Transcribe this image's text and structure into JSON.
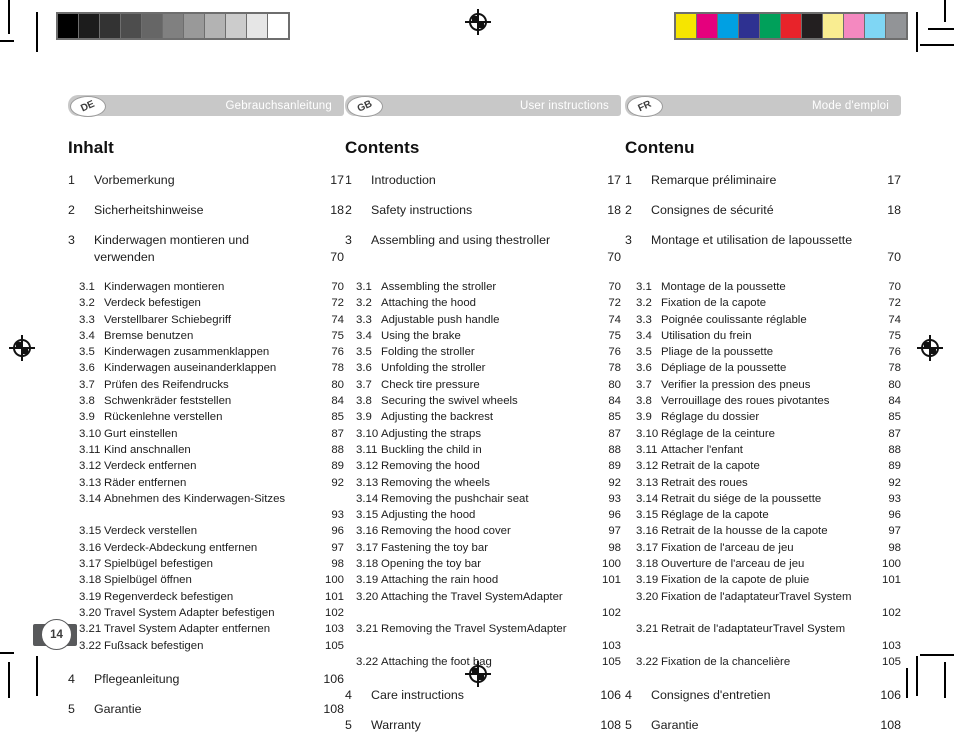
{
  "print_marks": {
    "gray_wedge": [
      "#000000",
      "#1c1c1c",
      "#333333",
      "#4d4d4d",
      "#666666",
      "#808080",
      "#999999",
      "#b3b3b3",
      "#cccccc",
      "#e6e6e6",
      "#ffffff"
    ],
    "color_bar": [
      "#f6e500",
      "#e5007d",
      "#00a0e3",
      "#2e3191",
      "#00a05a",
      "#e8232a",
      "#231f20",
      "#f9ed91",
      "#f489c0",
      "#7fd6f4",
      "#929497"
    ]
  },
  "page_footer": {
    "page_number": "14"
  },
  "columns": [
    {
      "code": "DE",
      "header": "Gebrauchsanleitung",
      "title": "Inhalt",
      "entries": [
        {
          "level": 1,
          "num": "1",
          "text": "Vorbemerkung",
          "page": "17"
        },
        {
          "level": 1,
          "num": "2",
          "text": "Sicherheitshinweise",
          "page": "18"
        },
        {
          "level": 1,
          "num": "3",
          "text": "Kinderwagen montieren und verwenden",
          "page": "70",
          "wrap": true
        },
        {
          "level": 2,
          "num": "3.1",
          "text": "Kinderwagen montieren",
          "page": "70"
        },
        {
          "level": 2,
          "num": "3.2",
          "text": "Verdeck befestigen",
          "page": "72"
        },
        {
          "level": 2,
          "num": "3.3",
          "text": "Verstellbarer Schiebegriff",
          "page": "74"
        },
        {
          "level": 2,
          "num": "3.4",
          "text": "Bremse benutzen",
          "page": "75"
        },
        {
          "level": 2,
          "num": "3.5",
          "text": "Kinderwagen zusammenklappen",
          "page": "76"
        },
        {
          "level": 2,
          "num": "3.6",
          "text": "Kinderwagen auseinanderklappen",
          "page": "78"
        },
        {
          "level": 2,
          "num": "3.7",
          "text": "Prüfen des Reifendrucks",
          "page": "80"
        },
        {
          "level": 2,
          "num": "3.8",
          "text": "Schwenkräder feststellen",
          "page": "84"
        },
        {
          "level": 2,
          "num": "3.9",
          "text": "Rückenlehne verstellen",
          "page": "85"
        },
        {
          "level": 2,
          "num": "3.10",
          "text": "Gurt einstellen",
          "page": "87"
        },
        {
          "level": 2,
          "num": "3.11",
          "text": "Kind anschnallen",
          "page": "88"
        },
        {
          "level": 2,
          "num": "3.12",
          "text": "Verdeck entfernen",
          "page": "89"
        },
        {
          "level": 2,
          "num": "3.13",
          "text": "Räder entfernen",
          "page": "92"
        },
        {
          "level": 2,
          "num": "3.14",
          "text": "Abnehmen des Kinderwagen-Sitzes",
          "page": "93",
          "wrap": true,
          "line1": "Abnehmen des Kinderwagen-",
          "line2": "Sitzes"
        },
        {
          "level": 2,
          "num": "3.15",
          "text": "Verdeck verstellen",
          "page": "96"
        },
        {
          "level": 2,
          "num": "3.16",
          "text": "Verdeck-Abdeckung entfernen",
          "page": "97"
        },
        {
          "level": 2,
          "num": "3.17",
          "text": "Spielbügel befestigen",
          "page": "98"
        },
        {
          "level": 2,
          "num": "3.18",
          "text": "Spielbügel öffnen",
          "page": "100"
        },
        {
          "level": 2,
          "num": "3.19",
          "text": "Regenverdeck befestigen",
          "page": "101"
        },
        {
          "level": 2,
          "num": "3.20",
          "text": "Travel System Adapter befestigen",
          "page": "102"
        },
        {
          "level": 2,
          "num": "3.21",
          "text": "Travel System Adapter entfernen",
          "page": "103"
        },
        {
          "level": 2,
          "num": "3.22",
          "text": "Fußsack befestigen",
          "page": "105"
        },
        {
          "level": 1,
          "num": "4",
          "text": "Pflegeanleitung",
          "page": "106",
          "spaced": true
        },
        {
          "level": 1,
          "num": "5",
          "text": "Garantie",
          "page": "108"
        }
      ]
    },
    {
      "code": "GB",
      "header": "User instructions",
      "title": "Contents",
      "entries": [
        {
          "level": 1,
          "num": "1",
          "text": "Introduction",
          "page": "17"
        },
        {
          "level": 1,
          "num": "2",
          "text": "Safety instructions",
          "page": "18"
        },
        {
          "level": 1,
          "num": "3",
          "text": "Assembling and using the stroller",
          "page": "70",
          "wrap": true,
          "line1": "Assembling and using the",
          "line2": "stroller"
        },
        {
          "level": 2,
          "num": "3.1",
          "text": "Assembling the stroller",
          "page": "70"
        },
        {
          "level": 2,
          "num": "3.2",
          "text": "Attaching the hood",
          "page": "72"
        },
        {
          "level": 2,
          "num": "3.3",
          "text": "Adjustable push handle",
          "page": "74"
        },
        {
          "level": 2,
          "num": "3.4",
          "text": "Using the brake",
          "page": "75"
        },
        {
          "level": 2,
          "num": "3.5",
          "text": "Folding the stroller",
          "page": "76"
        },
        {
          "level": 2,
          "num": "3.6",
          "text": "Unfolding the stroller",
          "page": "78"
        },
        {
          "level": 2,
          "num": "3.7",
          "text": "Check tire pressure",
          "page": "80"
        },
        {
          "level": 2,
          "num": "3.8",
          "text": "Securing the swivel wheels",
          "page": "84"
        },
        {
          "level": 2,
          "num": "3.9",
          "text": "Adjusting the backrest",
          "page": "85"
        },
        {
          "level": 2,
          "num": "3.10",
          "text": "Adjusting the straps",
          "page": "87"
        },
        {
          "level": 2,
          "num": "3.11",
          "text": "Buckling the child in",
          "page": "88"
        },
        {
          "level": 2,
          "num": "3.12",
          "text": "Removing the hood",
          "page": "89"
        },
        {
          "level": 2,
          "num": "3.13",
          "text": "Removing the wheels",
          "page": "92"
        },
        {
          "level": 2,
          "num": "3.14",
          "text": "Removing the pushchair seat",
          "page": "93"
        },
        {
          "level": 2,
          "num": "3.15",
          "text": "Adjusting the hood",
          "page": "96"
        },
        {
          "level": 2,
          "num": "3.16",
          "text": "Removing the hood cover",
          "page": "97"
        },
        {
          "level": 2,
          "num": "3.17",
          "text": "Fastening the toy bar",
          "page": "98"
        },
        {
          "level": 2,
          "num": "3.18",
          "text": "Opening the toy bar",
          "page": "100"
        },
        {
          "level": 2,
          "num": "3.19",
          "text": "Attaching the rain hood",
          "page": "101"
        },
        {
          "level": 2,
          "num": "3.20",
          "text": "Attaching the Travel System Adapter",
          "page": "102",
          "wrap": true,
          "line1": "Attaching the Travel System",
          "line2": "Adapter"
        },
        {
          "level": 2,
          "num": "3.21",
          "text": "Removing the Travel System Adapter",
          "page": "103",
          "wrap": true,
          "line1": "Removing the Travel System",
          "line2": "Adapter"
        },
        {
          "level": 2,
          "num": "3.22",
          "text": "Attaching the foot bag",
          "page": "105"
        },
        {
          "level": 1,
          "num": "4",
          "text": "Care instructions",
          "page": "106",
          "spaced": true
        },
        {
          "level": 1,
          "num": "5",
          "text": "Warranty",
          "page": "108"
        }
      ]
    },
    {
      "code": "FR",
      "header": "Mode d'emploi",
      "title": "Contenu",
      "entries": [
        {
          "level": 1,
          "num": "1",
          "text": "Remarque préliminaire",
          "page": "17"
        },
        {
          "level": 1,
          "num": "2",
          "text": "Consignes de sécurité",
          "page": "18"
        },
        {
          "level": 1,
          "num": "3",
          "text": "Montage et utilisation de la poussette",
          "page": "70",
          "wrap": true,
          "line1": "Montage et utilisation de la",
          "line2": "poussette"
        },
        {
          "level": 2,
          "num": "3.1",
          "text": "Montage de la poussette",
          "page": "70"
        },
        {
          "level": 2,
          "num": "3.2",
          "text": "Fixation de la capote",
          "page": "72"
        },
        {
          "level": 2,
          "num": "3.3",
          "text": "Poignée coulissante réglable",
          "page": "74"
        },
        {
          "level": 2,
          "num": "3.4",
          "text": "Utilisation du frein",
          "page": "75"
        },
        {
          "level": 2,
          "num": "3.5",
          "text": "Pliage de la poussette",
          "page": "76"
        },
        {
          "level": 2,
          "num": "3.6",
          "text": "Dépliage de la poussette",
          "page": "78"
        },
        {
          "level": 2,
          "num": "3.7",
          "text": "Verifier la pression des pneus",
          "page": "80"
        },
        {
          "level": 2,
          "num": "3.8",
          "text": "Verrouillage des roues pivotantes",
          "page": "84"
        },
        {
          "level": 2,
          "num": "3.9",
          "text": "Réglage du dossier",
          "page": "85"
        },
        {
          "level": 2,
          "num": "3.10",
          "text": "Réglage de la ceinture",
          "page": "87"
        },
        {
          "level": 2,
          "num": "3.11",
          "text": "Attacher l'enfant",
          "page": "88"
        },
        {
          "level": 2,
          "num": "3.12",
          "text": "Retrait de la capote",
          "page": "89"
        },
        {
          "level": 2,
          "num": "3.13",
          "text": "Retrait des roues",
          "page": "92"
        },
        {
          "level": 2,
          "num": "3.14",
          "text": "Retrait du siége de la poussette",
          "page": "93"
        },
        {
          "level": 2,
          "num": "3.15",
          "text": "Réglage de la capote",
          "page": "96"
        },
        {
          "level": 2,
          "num": "3.16",
          "text": "Retrait de la housse de la capote",
          "page": "97"
        },
        {
          "level": 2,
          "num": "3.17",
          "text": "Fixation de l'arceau de jeu",
          "page": "98"
        },
        {
          "level": 2,
          "num": "3.18",
          "text": "Ouverture de l'arceau de jeu",
          "page": "100"
        },
        {
          "level": 2,
          "num": "3.19",
          "text": "Fixation de la capote de pluie",
          "page": "101"
        },
        {
          "level": 2,
          "num": "3.20",
          "text": "Fixation de l'adaptateur Travel System",
          "page": "102",
          "wrap": true,
          "line1": "Fixation de l'adaptateur",
          "line2": "Travel System"
        },
        {
          "level": 2,
          "num": "3.21",
          "text": "Retrait de l'adaptateur Travel System",
          "page": "103",
          "wrap": true,
          "line1": "Retrait de l'adaptateur",
          "line2": "Travel System"
        },
        {
          "level": 2,
          "num": "3.22",
          "text": "Fixation de la chancelière",
          "page": "105"
        },
        {
          "level": 1,
          "num": "4",
          "text": "Consignes d'entretien",
          "page": "106",
          "spaced": true
        },
        {
          "level": 1,
          "num": "5",
          "text": "Garantie",
          "page": "108"
        }
      ]
    }
  ]
}
